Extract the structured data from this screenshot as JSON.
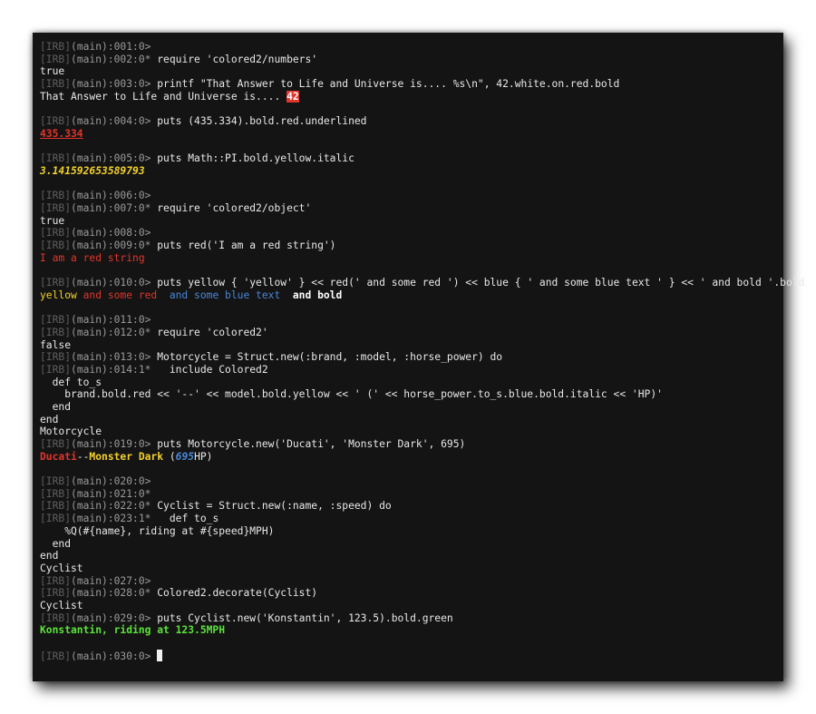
{
  "session": {
    "irb": "[IRB]",
    "lines": [
      {
        "prompt": "(main):001:0>",
        "code": ""
      },
      {
        "prompt": "(main):002:0*",
        "code": " require 'colored2/numbers'"
      },
      {
        "out": "true"
      },
      {
        "prompt": "(main):003:0>",
        "code": " printf \"That Answer to Life and Universe is.... %s\\n\", 42.white.on.red.bold"
      },
      {
        "out": "That Answer to Life and Universe is.... ",
        "badge": "42"
      },
      {
        "blank": true
      },
      {
        "prompt": "(main):004:0>",
        "code": " puts (435.334).bold.red.underlined"
      },
      {
        "styled": [
          {
            "t": "435.334",
            "c": "red b u"
          }
        ]
      },
      {
        "blank": true
      },
      {
        "prompt": "(main):005:0>",
        "code": " puts Math::PI.bold.yellow.italic"
      },
      {
        "styled": [
          {
            "t": "3.141592653589793",
            "c": "yel b i"
          }
        ]
      },
      {
        "blank": true
      },
      {
        "prompt": "(main):006:0>",
        "code": ""
      },
      {
        "prompt": "(main):007:0*",
        "code": " require 'colored2/object'"
      },
      {
        "out": "true"
      },
      {
        "prompt": "(main):008:0>",
        "code": ""
      },
      {
        "prompt": "(main):009:0*",
        "code": " puts red('I am a red string')"
      },
      {
        "styled": [
          {
            "t": "I am a red string",
            "c": "red"
          }
        ]
      },
      {
        "blank": true
      },
      {
        "prompt": "(main):010:0>",
        "code": " puts yellow { 'yellow' } << red(' and some red ') << blue { ' and some blue text ' } << ' and bold '.bold"
      },
      {
        "styled": [
          {
            "t": "yellow",
            "c": "yel"
          },
          {
            "t": " and some red ",
            "c": "red"
          },
          {
            "t": " and some blue text ",
            "c": "blu"
          },
          {
            "t": " and bold ",
            "c": "wht b"
          }
        ]
      },
      {
        "blank": true
      },
      {
        "prompt": "(main):011:0>",
        "code": ""
      },
      {
        "prompt": "(main):012:0*",
        "code": " require 'colored2'"
      },
      {
        "out": "false"
      },
      {
        "prompt": "(main):013:0>",
        "code": " Motorcycle = Struct.new(:brand, :model, :horse_power) do"
      },
      {
        "prompt": "(main):014:1*",
        "code": "   include Colored2"
      },
      {
        "out": "  def to_s"
      },
      {
        "out": "    brand.bold.red << '--' << model.bold.yellow << ' (' << horse_power.to_s.blue.bold.italic << 'HP)'"
      },
      {
        "out": "  end"
      },
      {
        "out": "end"
      },
      {
        "out": "Motorcycle"
      },
      {
        "prompt": "(main):019:0>",
        "code": " puts Motorcycle.new('Ducati', 'Monster Dark', 695)"
      },
      {
        "styled": [
          {
            "t": "Ducati",
            "c": "red b"
          },
          {
            "t": "--",
            "c": ""
          },
          {
            "t": "Monster Dark",
            "c": "yel b"
          },
          {
            "t": " (",
            "c": ""
          },
          {
            "t": "695",
            "c": "blu b i"
          },
          {
            "t": "HP)",
            "c": ""
          }
        ]
      },
      {
        "blank": true
      },
      {
        "prompt": "(main):020:0>",
        "code": ""
      },
      {
        "prompt": "(main):021:0*",
        "code": ""
      },
      {
        "prompt": "(main):022:0*",
        "code": " Cyclist = Struct.new(:name, :speed) do"
      },
      {
        "prompt": "(main):023:1*",
        "code": "   def to_s"
      },
      {
        "out": "    %Q(#{name}, riding at #{speed}MPH)"
      },
      {
        "out": "  end"
      },
      {
        "out": "end"
      },
      {
        "out": "Cyclist"
      },
      {
        "prompt": "(main):027:0>",
        "code": ""
      },
      {
        "prompt": "(main):028:0*",
        "code": " Colored2.decorate(Cyclist)"
      },
      {
        "out": "Cyclist"
      },
      {
        "prompt": "(main):029:0>",
        "code": " puts Cyclist.new('Konstantin', 123.5).bold.green"
      },
      {
        "styled": [
          {
            "t": "Konstantin, riding at 123.5MPH",
            "c": "grn b"
          }
        ]
      },
      {
        "blank": true
      },
      {
        "prompt": "(main):030:0>",
        "code": " ",
        "cursor": true
      }
    ]
  }
}
